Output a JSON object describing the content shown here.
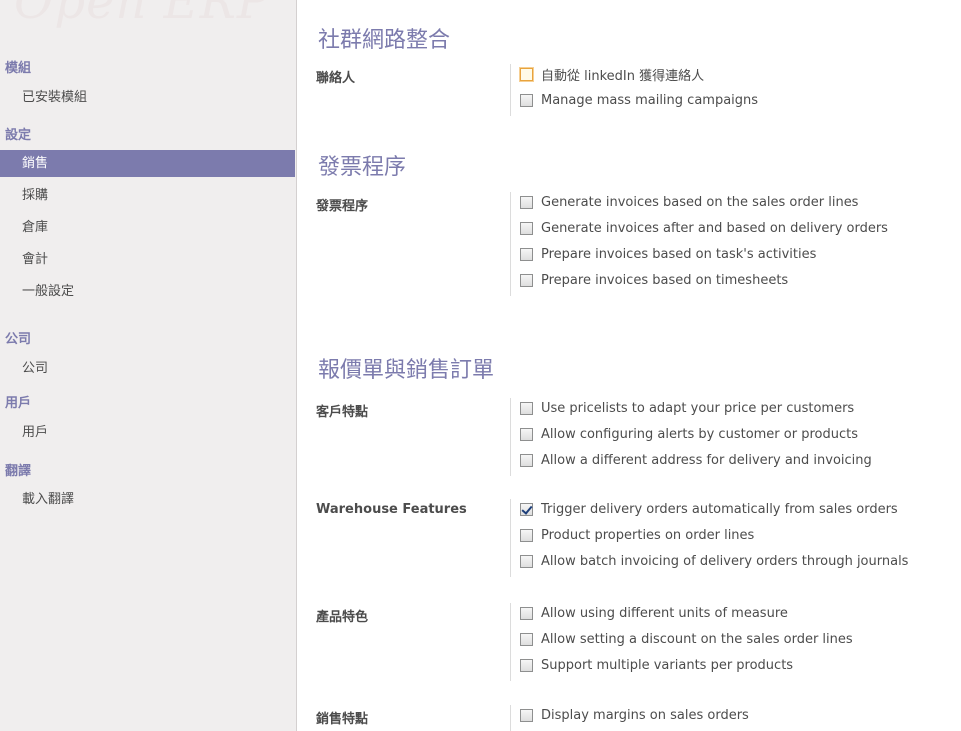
{
  "logo": {
    "text": "Open ERP"
  },
  "sidebar": {
    "sections": [
      {
        "title": "模組",
        "items": [
          {
            "label": "已安裝模組"
          }
        ]
      },
      {
        "title": "設定",
        "items": [
          {
            "label": "銷售",
            "active": true
          },
          {
            "label": "採購"
          },
          {
            "label": "倉庫"
          },
          {
            "label": "會計"
          },
          {
            "label": "一般設定"
          }
        ]
      },
      {
        "title": "公司",
        "items": [
          {
            "label": "公司"
          }
        ]
      },
      {
        "title": "用戶",
        "items": [
          {
            "label": "用戶"
          }
        ]
      },
      {
        "title": "翻譯",
        "items": [
          {
            "label": "載入翻譯"
          }
        ]
      }
    ]
  },
  "main": {
    "sections": [
      {
        "heading": "社群網路整合",
        "groups": [
          {
            "label": "聯絡人",
            "options": [
              {
                "label": "自動從 linkedIn 獲得連絡人",
                "checked": false,
                "focused": true
              },
              {
                "label": "Manage mass mailing campaigns",
                "checked": false
              }
            ]
          }
        ]
      },
      {
        "heading": "發票程序",
        "groups": [
          {
            "label": "發票程序",
            "options": [
              {
                "label": "Generate invoices based on the sales order lines",
                "checked": false
              },
              {
                "label": "Generate invoices after and based on delivery orders",
                "checked": false
              },
              {
                "label": "Prepare invoices based on task's activities",
                "checked": false
              },
              {
                "label": "Prepare invoices based on timesheets",
                "checked": false
              }
            ]
          }
        ]
      },
      {
        "heading": "報價單與銷售訂單",
        "groups": [
          {
            "label": "客戶特點",
            "options": [
              {
                "label": "Use pricelists to adapt your price per customers",
                "checked": false
              },
              {
                "label": "Allow configuring alerts by customer or products",
                "checked": false
              },
              {
                "label": "Allow a different address for delivery and invoicing",
                "checked": false
              }
            ]
          },
          {
            "label": "Warehouse Features",
            "options": [
              {
                "label": "Trigger delivery orders automatically from sales orders",
                "checked": true
              },
              {
                "label": "Product properties on order lines",
                "checked": false
              },
              {
                "label": "Allow batch invoicing of delivery orders through journals",
                "checked": false
              }
            ]
          },
          {
            "label": "產品特色",
            "options": [
              {
                "label": "Allow using different units of measure",
                "checked": false
              },
              {
                "label": "Allow setting a discount on the sales order lines",
                "checked": false
              },
              {
                "label": "Support multiple variants per products",
                "checked": false
              }
            ]
          },
          {
            "label": "銷售特點",
            "options": [
              {
                "label": "Display margins on sales orders",
                "checked": false
              }
            ]
          }
        ]
      }
    ]
  }
}
